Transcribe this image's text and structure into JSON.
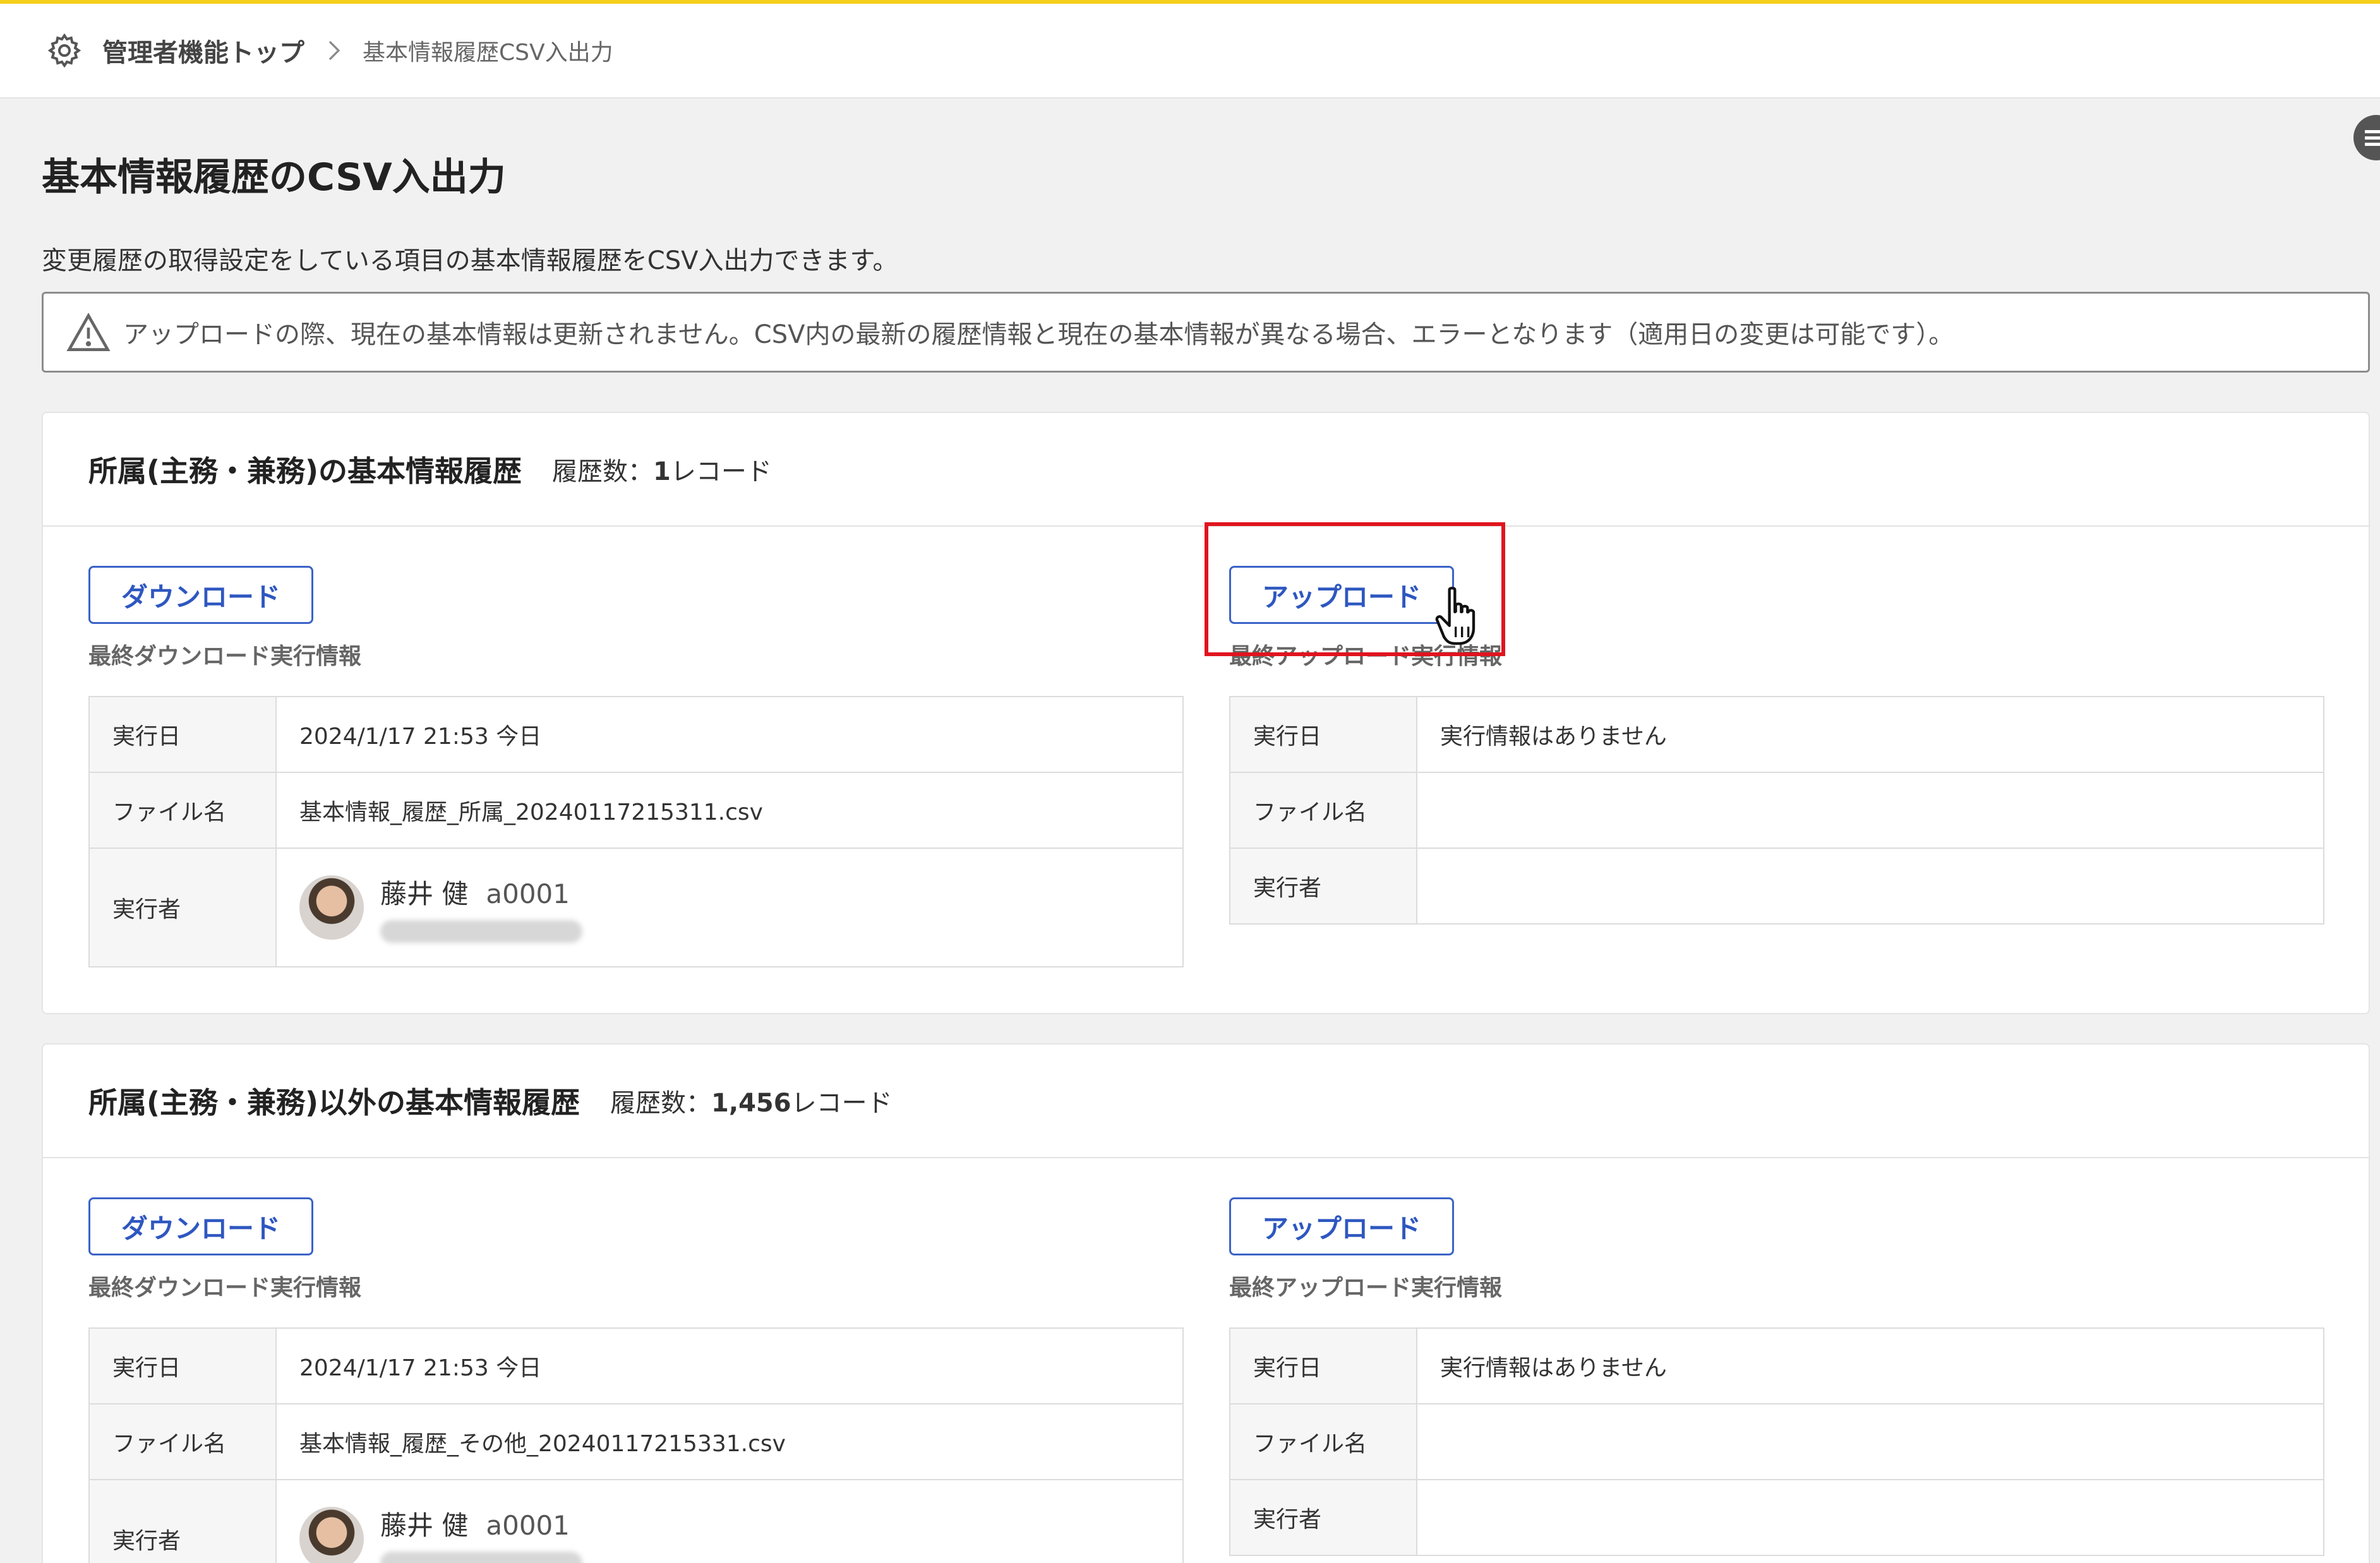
{
  "breadcrumb": {
    "top": "管理者機能トップ",
    "current": "基本情報履歴CSV入出力"
  },
  "page": {
    "title": "基本情報履歴のCSV入出力",
    "description": "変更履歴の取得設定をしている項目の基本情報履歴をCSV入出力できます。",
    "notice": "アップロードの際、現在の基本情報は更新されません。CSV内の最新の履歴情報と現在の基本情報が異なる場合、エラーとなります（適用日の変更は可能です）。"
  },
  "icons": {
    "gear": "gear-icon",
    "chevron": "chevron-right-icon",
    "warning": "warning-icon",
    "cursor": "hand-pointer-icon"
  },
  "colors": {
    "accent": "#3b63c8",
    "highlight": "#e0141e",
    "topline": "#f6cf1c"
  },
  "sections": [
    {
      "title": "所属(主務・兼務)の基本情報履歴",
      "count_label": "履歴数：",
      "count_value": "1",
      "count_unit": "レコード",
      "download": {
        "button": "ダウンロード",
        "label": "最終ダウンロード実行情報",
        "rows": {
          "date_key": "実行日",
          "date_val": "2024/1/17 21:53 今日",
          "file_key": "ファイル名",
          "file_val": "基本情報_履歴_所属_20240117215311.csv",
          "user_key": "実行者",
          "user_name": "藤井 健",
          "user_id": "a0001"
        }
      },
      "upload": {
        "button": "アップロード",
        "label": "最終アップロード実行情報",
        "rows": {
          "date_key": "実行日",
          "date_val": "実行情報はありません",
          "file_key": "ファイル名",
          "user_key": "実行者"
        }
      }
    },
    {
      "title": "所属(主務・兼務)以外の基本情報履歴",
      "count_label": "履歴数：",
      "count_value": "1,456",
      "count_unit": "レコード",
      "download": {
        "button": "ダウンロード",
        "label": "最終ダウンロード実行情報",
        "rows": {
          "date_key": "実行日",
          "date_val": "2024/1/17 21:53 今日",
          "file_key": "ファイル名",
          "file_val": "基本情報_履歴_その他_20240117215331.csv",
          "user_key": "実行者",
          "user_name": "藤井 健",
          "user_id": "a0001"
        }
      },
      "upload": {
        "button": "アップロード",
        "label": "最終アップロード実行情報",
        "rows": {
          "date_key": "実行日",
          "date_val": "実行情報はありません",
          "file_key": "ファイル名",
          "user_key": "実行者"
        }
      }
    }
  ]
}
